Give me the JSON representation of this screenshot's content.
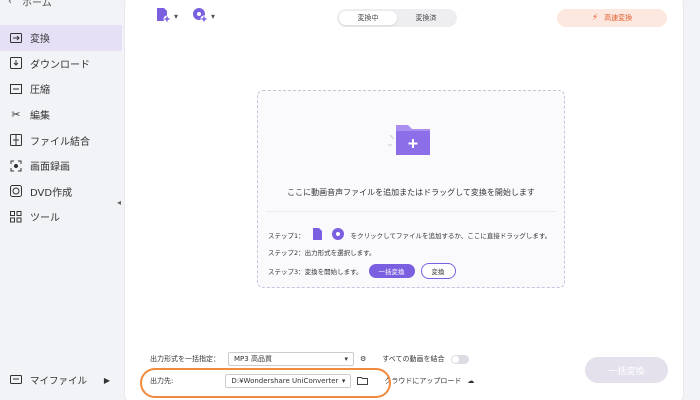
{
  "sidebar": {
    "home_label": "ホーム",
    "items": [
      {
        "label": "変換",
        "icon": "convert-icon",
        "active": true
      },
      {
        "label": "ダウンロード",
        "icon": "download-icon"
      },
      {
        "label": "圧縮",
        "icon": "compress-icon"
      },
      {
        "label": "編集",
        "icon": "scissors-icon"
      },
      {
        "label": "ファイル結合",
        "icon": "merge-icon"
      },
      {
        "label": "画面録画",
        "icon": "screen-record-icon"
      },
      {
        "label": "DVD作成",
        "icon": "dvd-icon"
      },
      {
        "label": "ツール",
        "icon": "tools-icon"
      }
    ],
    "myfiles_label": "マイファイル"
  },
  "header": {
    "tabs": [
      "変換中",
      "変換済"
    ],
    "selected_tab": "変換中",
    "fast_convert_label": "高速変換"
  },
  "dropzone": {
    "main_text": "ここに動画音声ファイルを追加またはドラッグして変換を開始します",
    "step1_prefix": "ステップ1：",
    "step1_suffix": "をクリックしてファイルを追加するか、ここに直接ドラッグします。",
    "step2": "ステップ2：出力形式を選択します。",
    "step3": "ステップ3：変換を開始します。",
    "step3_btn_all": "一括変換",
    "step3_btn_convert": "変換"
  },
  "bottom": {
    "format_label": "出力形式を一括指定：",
    "format_value": "MP3 高品質",
    "merge_label": "すべての動画を結合",
    "output_label": "出力先:",
    "output_value": "D:¥Wondershare UniConverter",
    "cloud_label": "クラウドにアップロード",
    "convert_all_label": "一括変換"
  },
  "colors": {
    "accent": "#7a5fe0",
    "highlight": "#f08a3c",
    "fast": "#e05a2b"
  }
}
